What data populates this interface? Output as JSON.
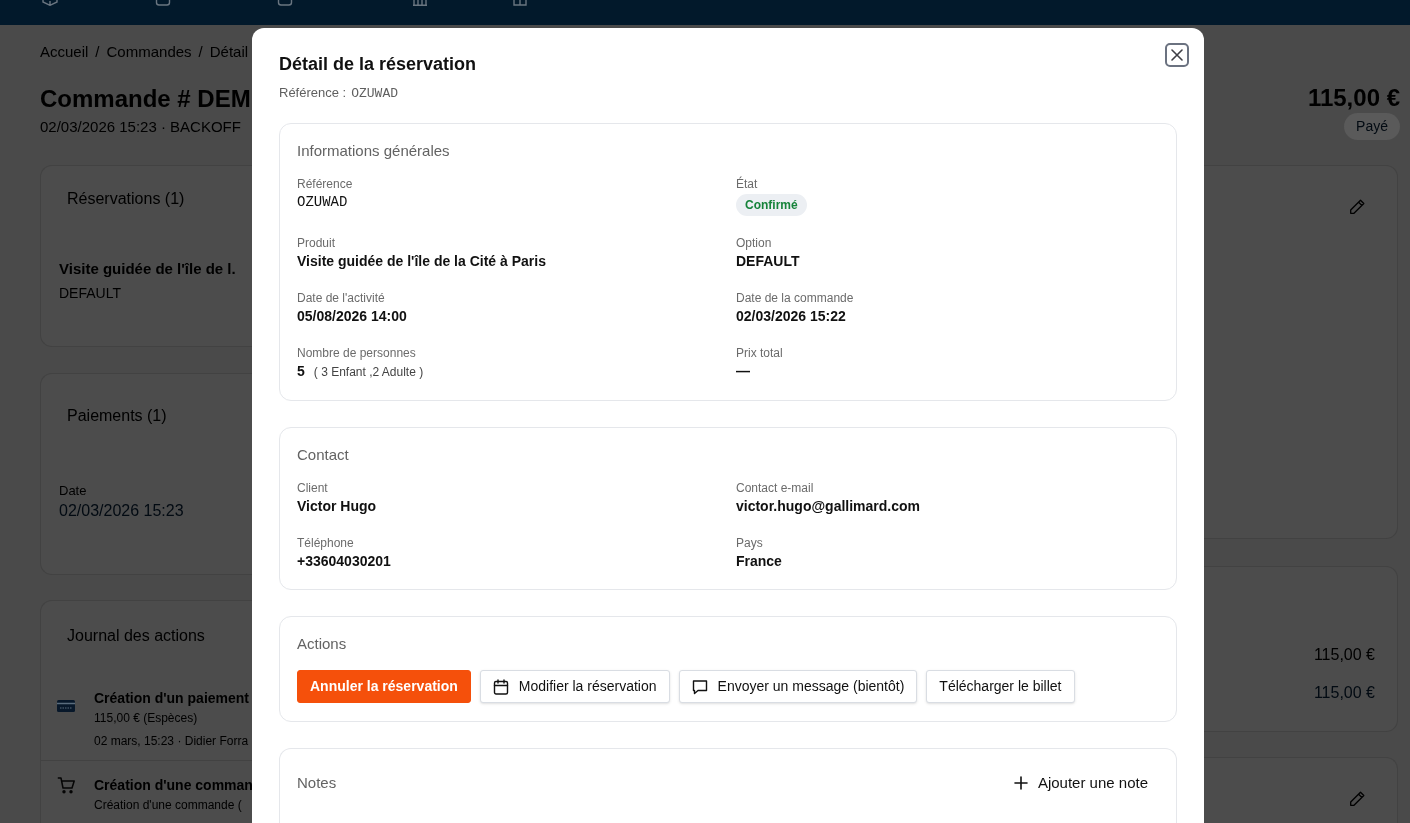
{
  "breadcrumb": {
    "items": [
      "Accueil",
      "Commandes",
      "Détail"
    ],
    "separators": [
      "/",
      "/"
    ]
  },
  "order": {
    "title": "Commande # DEM",
    "subtitle": "02/03/2026 15:23 · BACKOFF",
    "total": "115,00 €",
    "payment_status": "Payé"
  },
  "reservations_card": {
    "title": "Réservations (1)",
    "product": "Visite guidée de l'île de l.",
    "option": "DEFAULT"
  },
  "payments_card": {
    "title": "Paiements (1)",
    "date_label": "Date",
    "date": "02/03/2026 15:23"
  },
  "journal_card": {
    "title": "Journal des actions",
    "entries": [
      {
        "kind": "payment",
        "title": "Création d'un paiement",
        "detail": "115,00 € (Espèces)",
        "meta": "02 mars, 15:23 · Didier Forra"
      },
      {
        "kind": "order",
        "title": "Création d'une comman",
        "detail": "Création d'une commande ("
      }
    ]
  },
  "summary_card": {
    "amounts": [
      {
        "kind": "plain",
        "value": "115,00 €"
      },
      {
        "kind": "link",
        "value": "115,00 €"
      }
    ]
  },
  "modal": {
    "title": "Détail de la réservation",
    "reference": {
      "label": "Référence :",
      "value": "OZUWAD"
    },
    "info": {
      "title": "Informations générales",
      "fields": [
        {
          "kind": "code",
          "label": "Référence",
          "value": "OZUWAD"
        },
        {
          "kind": "badge",
          "label": "État",
          "value": "Confirmé"
        },
        {
          "kind": "text",
          "label": "Produit",
          "value": "Visite guidée de l'île de la Cité à Paris"
        },
        {
          "kind": "text",
          "label": "Option",
          "value": "DEFAULT"
        },
        {
          "kind": "text",
          "label": "Date de l'activité",
          "value": "05/08/2026 14:00"
        },
        {
          "kind": "text",
          "label": "Date de la commande",
          "value": "02/03/2026 15:22"
        },
        {
          "kind": "text",
          "label": "Nombre de personnes",
          "value": "5",
          "detail": "( 3 Enfant ,2 Adulte )"
        },
        {
          "kind": "text",
          "label": "Prix total",
          "value": "—"
        }
      ]
    },
    "contact": {
      "title": "Contact",
      "fields": [
        {
          "kind": "text",
          "label": "Client",
          "value": "Victor Hugo"
        },
        {
          "kind": "text",
          "label": "Contact e-mail",
          "value": "victor.hugo@gallimard.com"
        },
        {
          "kind": "text",
          "label": "Téléphone",
          "value": "+33604030201"
        },
        {
          "kind": "text",
          "label": "Pays",
          "value": "France"
        }
      ]
    },
    "actions": {
      "title": "Actions",
      "buttons": [
        {
          "kind": "danger",
          "label": "Annuler la réservation"
        },
        {
          "kind": "edit",
          "label": "Modifier la réservation"
        },
        {
          "kind": "message",
          "label": "Envoyer un message (bientôt)"
        },
        {
          "kind": "download",
          "label": "Télécharger le billet"
        }
      ]
    },
    "notes": {
      "title": "Notes",
      "add_button": "Ajouter une note"
    }
  }
}
